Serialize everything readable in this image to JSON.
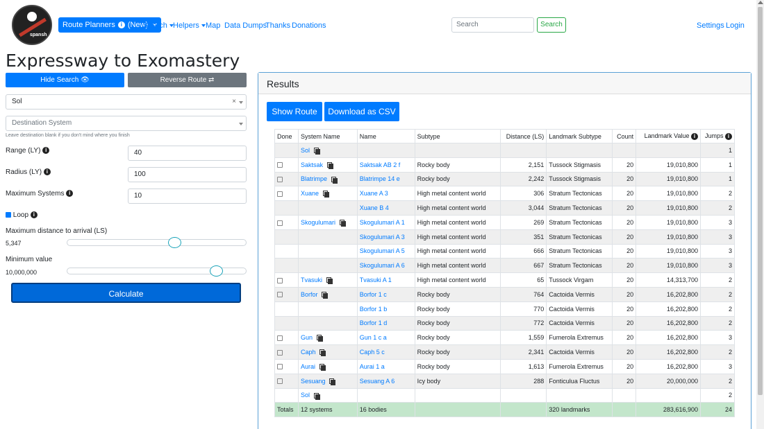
{
  "navbar": {
    "logo_text": "spansh",
    "route_planners": "Route Planners",
    "route_planners_badge": "(New)",
    "search": "Search",
    "helpers": "Helpers",
    "map": "Map",
    "data_dumps": "Data Dumps",
    "thanks": "Thanks",
    "donations": "Donations",
    "search_placeholder": "Search",
    "search_button": "Search",
    "settings": "Settings",
    "login": "Login"
  },
  "page": {
    "title": "Expressway to Exomastery"
  },
  "form": {
    "hide_search": "Hide Search",
    "reverse_route": "Reverse Route",
    "source_system": "Sol",
    "destination_placeholder": "Destination System",
    "destination_help": "Leave destination blank if you don't mind where you finish",
    "range_label": "Range (LY)",
    "range_value": "40",
    "radius_label": "Radius (LY)",
    "radius_value": "100",
    "max_systems_label": "Maximum Systems",
    "max_systems_value": "10",
    "loop_label": "Loop",
    "max_distance_label": "Maximum distance to arrival (LS)",
    "max_distance_value": "5,347",
    "max_distance_fraction": 0.61,
    "min_value_label": "Minimum value",
    "min_value_value": "10,000,000",
    "min_value_fraction": 0.86,
    "calculate": "Calculate"
  },
  "results": {
    "title": "Results",
    "show_route": "Show Route",
    "download_csv": "Download as CSV",
    "columns": [
      "Done",
      "System Name",
      "Name",
      "Subtype",
      "Distance (LS)",
      "Landmark Subtype",
      "Count",
      "Landmark Value",
      "Jumps"
    ],
    "rows": [
      {
        "cb": false,
        "system": "Sol",
        "name": "",
        "subtype": "",
        "distance": "",
        "landmark": "",
        "count": "",
        "value": "",
        "jumps": "1"
      },
      {
        "cb": true,
        "system": "Saktsak",
        "name": "Saktsak AB 2 f",
        "subtype": "Rocky body",
        "distance": "2,151",
        "landmark": "Tussock Stigmasis",
        "count": "20",
        "value": "19,010,800",
        "jumps": "1"
      },
      {
        "cb": true,
        "system": "Blatrimpe",
        "name": "Blatrimpe 14 e",
        "subtype": "Rocky body",
        "distance": "2,242",
        "landmark": "Tussock Stigmasis",
        "count": "20",
        "value": "19,010,800",
        "jumps": "1"
      },
      {
        "cb": true,
        "system": "Xuane",
        "name": "Xuane A 3",
        "subtype": "High metal content world",
        "distance": "306",
        "landmark": "Stratum Tectonicas",
        "count": "20",
        "value": "19,010,800",
        "jumps": "2"
      },
      {
        "cb": false,
        "system": "",
        "name": "Xuane B 4",
        "subtype": "High metal content world",
        "distance": "3,044",
        "landmark": "Stratum Tectonicas",
        "count": "20",
        "value": "19,010,800",
        "jumps": "2"
      },
      {
        "cb": true,
        "system": "Skogulumari",
        "name": "Skogulumari A 1",
        "subtype": "High metal content world",
        "distance": "269",
        "landmark": "Stratum Tectonicas",
        "count": "20",
        "value": "19,010,800",
        "jumps": "3"
      },
      {
        "cb": false,
        "system": "",
        "name": "Skogulumari A 3",
        "subtype": "High metal content world",
        "distance": "351",
        "landmark": "Stratum Tectonicas",
        "count": "20",
        "value": "19,010,800",
        "jumps": "3"
      },
      {
        "cb": false,
        "system": "",
        "name": "Skogulumari A 5",
        "subtype": "High metal content world",
        "distance": "666",
        "landmark": "Stratum Tectonicas",
        "count": "20",
        "value": "19,010,800",
        "jumps": "3"
      },
      {
        "cb": false,
        "system": "",
        "name": "Skogulumari A 6",
        "subtype": "High metal content world",
        "distance": "667",
        "landmark": "Stratum Tectonicas",
        "count": "20",
        "value": "19,010,800",
        "jumps": "3"
      },
      {
        "cb": true,
        "system": "Tvasuki",
        "name": "Tvasuki A 1",
        "subtype": "High metal content world",
        "distance": "65",
        "landmark": "Tussock Virgam",
        "count": "20",
        "value": "14,313,700",
        "jumps": "2"
      },
      {
        "cb": true,
        "system": "Borfor",
        "name": "Borfor 1 c",
        "subtype": "Rocky body",
        "distance": "764",
        "landmark": "Cactoida Vermis",
        "count": "20",
        "value": "16,202,800",
        "jumps": "2"
      },
      {
        "cb": false,
        "system": "",
        "name": "Borfor 1 b",
        "subtype": "Rocky body",
        "distance": "770",
        "landmark": "Cactoida Vermis",
        "count": "20",
        "value": "16,202,800",
        "jumps": "2"
      },
      {
        "cb": false,
        "system": "",
        "name": "Borfor 1 d",
        "subtype": "Rocky body",
        "distance": "772",
        "landmark": "Cactoida Vermis",
        "count": "20",
        "value": "16,202,800",
        "jumps": "2"
      },
      {
        "cb": true,
        "system": "Gun",
        "name": "Gun 1 c a",
        "subtype": "Rocky body",
        "distance": "1,559",
        "landmark": "Fumerola Extremus",
        "count": "20",
        "value": "16,202,800",
        "jumps": "3"
      },
      {
        "cb": true,
        "system": "Caph",
        "name": "Caph 5 c",
        "subtype": "Rocky body",
        "distance": "2,341",
        "landmark": "Cactoida Vermis",
        "count": "20",
        "value": "16,202,800",
        "jumps": "2"
      },
      {
        "cb": true,
        "system": "Aurai",
        "name": "Aurai 1 a",
        "subtype": "Rocky body",
        "distance": "1,613",
        "landmark": "Fumerola Extremus",
        "count": "20",
        "value": "16,202,800",
        "jumps": "3"
      },
      {
        "cb": true,
        "system": "Sesuang",
        "name": "Sesuang A 6",
        "subtype": "Icy body",
        "distance": "288",
        "landmark": "Fonticulua Fluctus",
        "count": "20",
        "value": "20,000,000",
        "jumps": "2"
      },
      {
        "cb": false,
        "system": "Sol",
        "name": "",
        "subtype": "",
        "distance": "",
        "landmark": "",
        "count": "",
        "value": "",
        "jumps": "2"
      }
    ],
    "totals": {
      "label": "Totals",
      "systems": "12 systems",
      "bodies": "16 bodies",
      "landmarks": "320 landmarks",
      "value": "283,616,900",
      "jumps": "24"
    }
  }
}
